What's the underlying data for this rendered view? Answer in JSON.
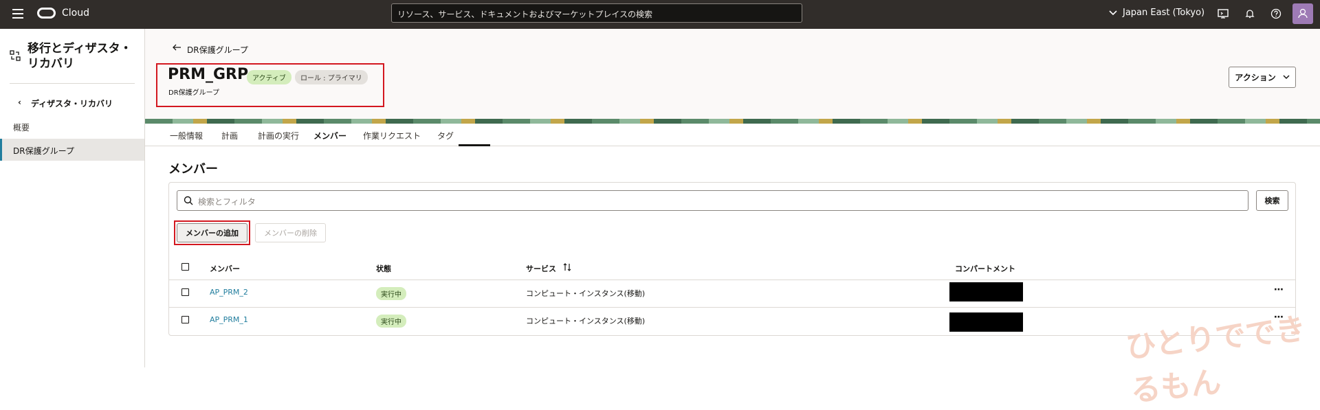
{
  "topbar": {
    "brand": "Cloud",
    "search_placeholder": "リソース、サービス、ドキュメントおよびマーケットプレイスの検索",
    "region": "Japan East (Tokyo)"
  },
  "leftnav": {
    "title": "移行とディザスタ・リカバリ",
    "back_label": "ディザスタ・リカバリ",
    "overview": "概要",
    "active_item": "DR保護グループ"
  },
  "header": {
    "back_link": "DR保護グループ",
    "title": "PRM_GRP",
    "badge_state": "アクティブ",
    "badge_role": "ロール : プライマリ",
    "subtitle": "DR保護グループ",
    "action_label": "アクション"
  },
  "tabs": [
    "一般情報",
    "計画",
    "計画の実行",
    "メンバー",
    "作業リクエスト",
    "タグ"
  ],
  "section_title": "メンバー",
  "filter_placeholder": "検索とフィルタ",
  "search_button": "検索",
  "add_button": "メンバーの追加",
  "delete_button": "メンバーの削除",
  "table": {
    "headers": [
      "メンバー",
      "状態",
      "サービス",
      "コンパートメント"
    ],
    "rows": [
      {
        "member": "AP_PRM_2",
        "status": "実行中",
        "service": "コンピュート・インスタンス(移動)"
      },
      {
        "member": "AP_PRM_1",
        "status": "実行中",
        "service": "コンピュート・インスタンス(移動)"
      }
    ]
  },
  "watermark": "ひとりでできるもん",
  "colors": {
    "topbar": "#312d2a",
    "link": "#227e9e",
    "highlight": "#d3171f",
    "status_bg": "#d4edbc"
  }
}
